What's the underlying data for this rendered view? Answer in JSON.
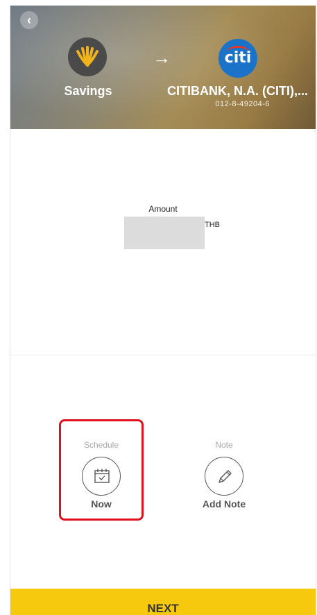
{
  "header": {
    "back_icon": "chevron-left-icon",
    "from_account": {
      "name": "Savings",
      "logo_icon": "krungsri-logo-icon",
      "logo_color": "#f0b31c"
    },
    "arrow": "→",
    "to_account": {
      "name": "CITIBANK, N.A. (CITI),...",
      "number": "012-8-49204-6",
      "logo_text": "citi",
      "logo_color": "#1a73c8"
    }
  },
  "amount": {
    "label": "Amount",
    "value": "",
    "currency": "THB"
  },
  "options": {
    "schedule": {
      "label": "Schedule",
      "value": "Now",
      "icon": "calendar-icon"
    },
    "note": {
      "label": "Note",
      "value": "Add Note",
      "icon": "pencil-icon"
    }
  },
  "next_button": {
    "label": "NEXT",
    "color": "#f6c90e"
  },
  "highlight_color": "#e0111e"
}
